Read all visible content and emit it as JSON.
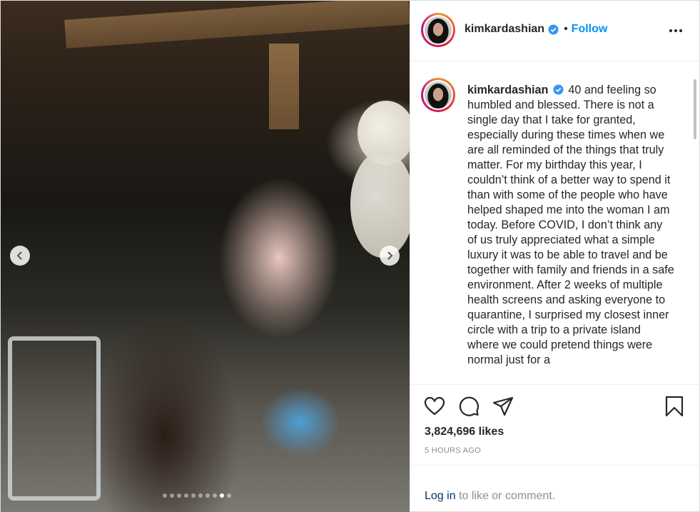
{
  "photo": {
    "nav_prev_icon": "chevron-left-icon",
    "nav_next_icon": "chevron-right-icon",
    "carousel_total": 10,
    "carousel_active_index": 8
  },
  "header": {
    "username": "kimkardashian",
    "verified_icon": "verified-badge-icon",
    "separator": "•",
    "follow_label": "Follow",
    "more_icon": "more-horizontal-icon"
  },
  "caption": {
    "username": "kimkardashian",
    "text": "40 and feeling so humbled and blessed. There is not a single day that I take for granted, especially during these times when we are all reminded of the things that truly matter. For my birthday this year, I couldn’t think of a better way to spend it than with some of the people who have helped shaped me into the woman I am today. Before COVID, I don’t think any of us truly appreciated what a simple luxury it was to be able to travel and be together with family and friends in a safe environment. After 2 weeks of multiple health screens and asking everyone to quarantine, I surprised my closest inner circle with a trip to a private island where we could pretend things were normal just for a"
  },
  "actions": {
    "like_icon": "heart-icon",
    "comment_icon": "comment-icon",
    "share_icon": "paper-plane-icon",
    "save_icon": "bookmark-icon",
    "likes": "3,824,696 likes",
    "timestamp": "5 HOURS AGO"
  },
  "comment_bar": {
    "login_label": "Log in",
    "rest_text": " to like or comment."
  },
  "colors": {
    "follow_blue": "#0095f6",
    "link_dark_blue": "#00376b",
    "muted_gray": "#8e8e8e",
    "verified_blue": "#3897f0"
  }
}
